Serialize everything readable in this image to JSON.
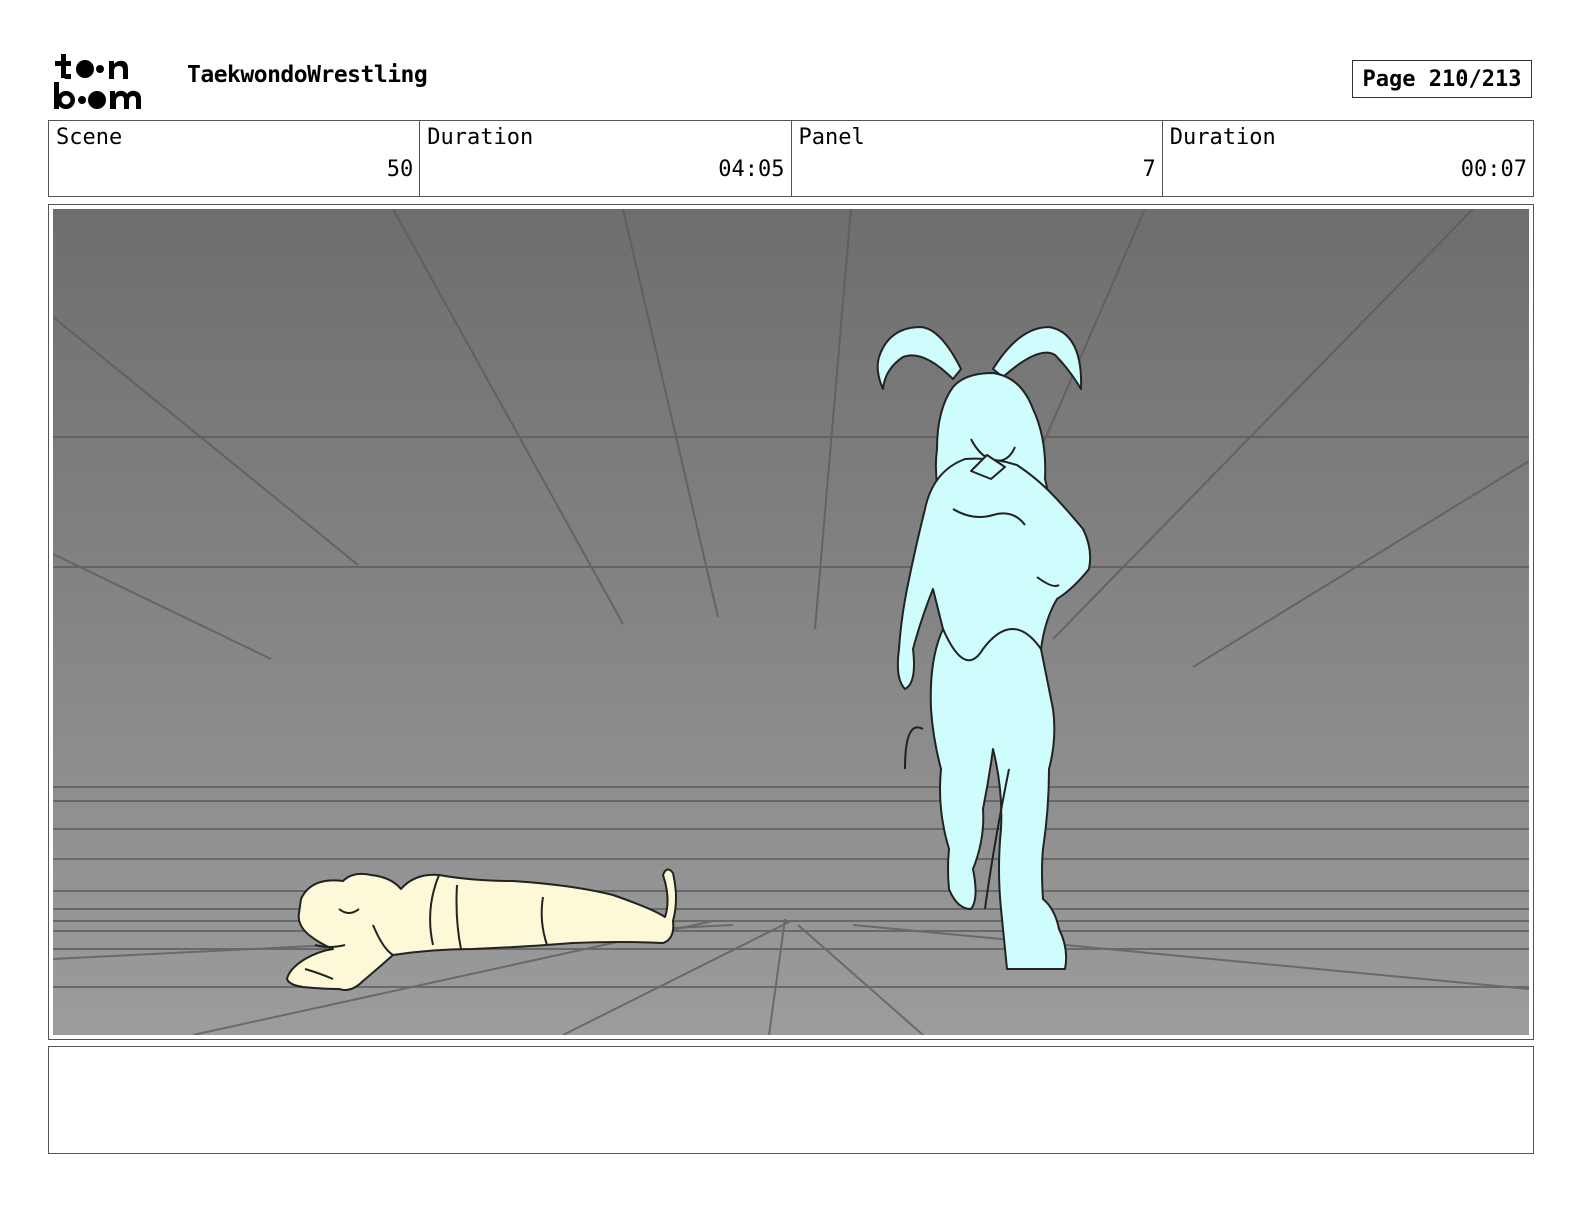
{
  "header": {
    "project_title": "TaekwondoWrestling",
    "page_label": "Page 210/213"
  },
  "info": {
    "scene_label": "Scene",
    "scene_value": "50",
    "duration_label": "Duration",
    "duration_value": "04:05",
    "panel_label": "Panel",
    "panel_value": "7",
    "panel_duration_label": "Duration",
    "panel_duration_value": "00:07"
  },
  "artwork": {
    "background_top": "#6e6e6e",
    "background_bottom": "#9c9c9c",
    "standing_figure_color": "#cffcfc",
    "lying_figure_color": "#fdf9d8"
  },
  "notes": {
    "text": ""
  }
}
